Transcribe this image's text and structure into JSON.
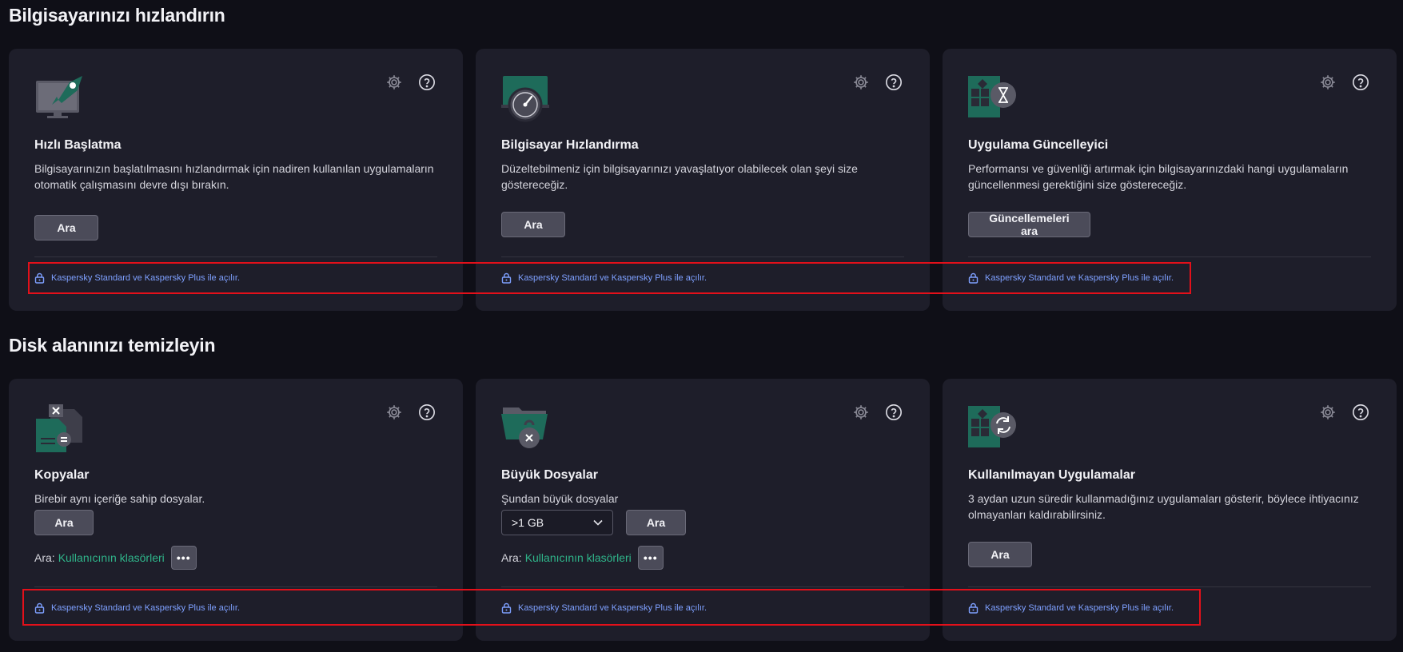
{
  "sections": {
    "speed_title": "Bilgisayarınızı hızlandırın",
    "disk_title": "Disk alanınızı temizleyin"
  },
  "lock_text": "Kaspersky Standard ve Kaspersky Plus ile açılır.",
  "cards": {
    "startup": {
      "title": "Hızlı Başlatma",
      "desc": "Bilgisayarınızın başlatılmasını hızlandırmak için nadiren kullanılan uygulamaların otomatik çalışmasını devre dışı bırakın.",
      "button": "Ara"
    },
    "speedup": {
      "title": "Bilgisayar Hızlandırma",
      "desc": "Düzeltebilmeniz için bilgisayarınızı yavaşlatıyor olabilecek olan şeyi size göstereceğiz.",
      "button": "Ara"
    },
    "updater": {
      "title": "Uygulama Güncelleyici",
      "desc": "Performansı ve güvenliği artırmak için bilgisayarınızdaki hangi uygulamaların güncellenmesi gerektiğini size göstereceğiz.",
      "button": "Güncellemeleri ara"
    },
    "duplicates": {
      "title": "Kopyalar",
      "desc": "Birebir aynı içeriğe sahip dosyalar.",
      "button": "Ara",
      "scope_label": "Ara:",
      "scope_link": "Kullanıcının klasörleri",
      "more": "•••"
    },
    "large_files": {
      "title": "Büyük Dosyalar",
      "desc": "Şundan büyük dosyalar",
      "select_value": ">1 GB",
      "button": "Ara",
      "scope_label": "Ara:",
      "scope_link": "Kullanıcının klasörleri",
      "more": "•••"
    },
    "unused": {
      "title": "Kullanılmayan Uygulamalar",
      "desc": "3 aydan uzun süredir kullanmadığınız uygulamaları gösterir, böylece ihtiyacınız olmayanları kaldırabilirsiniz.",
      "button": "Ara"
    }
  },
  "colors": {
    "background": "#0f0f17",
    "card": "#1e1e2a",
    "link_blue": "#7ea0ff",
    "link_green": "#2fb58a",
    "highlight_red": "#e3101a",
    "icon_teal": "#1e6b5a"
  }
}
